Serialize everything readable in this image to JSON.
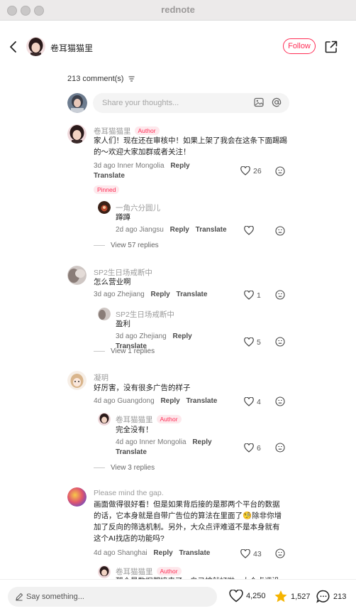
{
  "window": {
    "title": "rednote"
  },
  "header": {
    "author_name": "卷耳猫猫里",
    "follow_label": "Follow"
  },
  "comments_header": {
    "count_label": "213 comment(s)"
  },
  "composer": {
    "placeholder": "Share your thoughts..."
  },
  "labels": {
    "reply": "Reply",
    "translate": "Translate",
    "author_badge": "Author",
    "pinned": "Pinned"
  },
  "comments": [
    {
      "name": "卷耳猫猫里",
      "author": true,
      "text": "家人们！现在还在审核中！如果上架了我会在这条下面踢踢的～欢迎大家加群或者关注！",
      "time": "3d ago",
      "location": "Inner Mongolia",
      "likes": "26",
      "pinned": true,
      "replies": [
        {
          "name": "一角六分圆儿",
          "text": "蹲蹲",
          "time": "2d ago",
          "location": "Jiangsu",
          "likes": ""
        }
      ],
      "view_replies": "View 57 replies"
    },
    {
      "name": "SP2生日场戒断中",
      "text": "怎么营业啊",
      "time": "3d ago",
      "location": "Zhejiang",
      "likes": "1",
      "replies": [
        {
          "name": "SP2生日场戒断中",
          "text": "盈利",
          "time": "3d ago",
          "location": "Zhejiang",
          "likes": "5"
        }
      ],
      "view_replies": "View 1 replies"
    },
    {
      "name": "凝玥",
      "text": "好厉害，没有很多广告的样子",
      "time": "4d ago",
      "location": "Guangdong",
      "likes": "4",
      "replies": [
        {
          "name": "卷耳猫猫里",
          "author": true,
          "text": "完全没有！",
          "time": "4d ago",
          "location": "Inner Mongolia",
          "likes": "6"
        }
      ],
      "view_replies": "View 3 replies"
    },
    {
      "name": "Please mind the gap.",
      "text": "画面做得很好看！但是如果背后接的是那两个平台的数据的话，它本身就是自带广告位的算法在里面了🧐除非你增加了反向的筛选机制。另外，大众点评难道不是本身就有这个AI找店的功能吗?",
      "time": "4d ago",
      "location": "Shanghai",
      "likes": "43",
      "replies": [
        {
          "name": "卷耳猫猫里",
          "author": true,
          "text": "那个是数据都接来了，自己排就好啦，大众点评没",
          "time": "",
          "location": "",
          "likes": ""
        }
      ]
    }
  ],
  "bottom": {
    "say_placeholder": "Say something...",
    "likes": "4,250",
    "stars": "1,527",
    "comments": "213"
  },
  "colors": {
    "accent": "#ff2d55",
    "star": "#f5b400"
  }
}
